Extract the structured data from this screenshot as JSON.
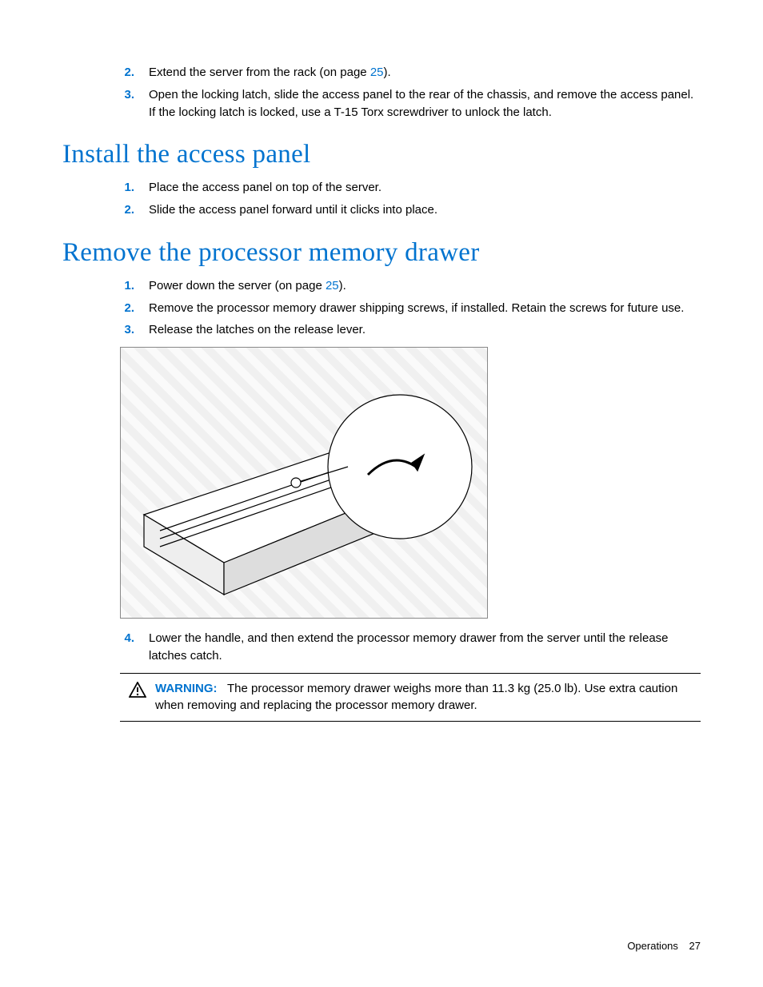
{
  "top_list": [
    {
      "num": "2.",
      "text_before": "Extend the server from the rack (on page ",
      "link": "25",
      "text_after": ")."
    },
    {
      "num": "3.",
      "text_before": "Open the locking latch, slide the access panel to the rear of the chassis, and remove the access panel. If the locking latch is locked, use a T-15 Torx screwdriver to unlock the latch.",
      "link": "",
      "text_after": ""
    }
  ],
  "section1": {
    "heading": "Install the access panel",
    "items": [
      {
        "num": "1.",
        "text": "Place the access panel on top of the server."
      },
      {
        "num": "2.",
        "text": "Slide the access panel forward until it clicks into place."
      }
    ]
  },
  "section2": {
    "heading": "Remove the processor memory drawer",
    "items_a": [
      {
        "num": "1.",
        "text_before": "Power down the server (on page ",
        "link": "25",
        "text_after": ")."
      },
      {
        "num": "2.",
        "text_before": "Remove the processor memory drawer shipping screws, if installed. Retain the screws for future use.",
        "link": "",
        "text_after": ""
      },
      {
        "num": "3.",
        "text_before": "Release the latches on the release lever.",
        "link": "",
        "text_after": ""
      }
    ],
    "figure_alt": "Server front with latch release detail callout",
    "items_b": [
      {
        "num": "4.",
        "text": "Lower the handle, and then extend the processor memory drawer from the server until the release latches catch."
      }
    ],
    "warning": {
      "label": "WARNING:",
      "text": "The processor memory drawer weighs more than 11.3 kg (25.0 lb). Use extra caution when removing and replacing the processor memory drawer."
    }
  },
  "footer": {
    "section": "Operations",
    "page": "27"
  }
}
